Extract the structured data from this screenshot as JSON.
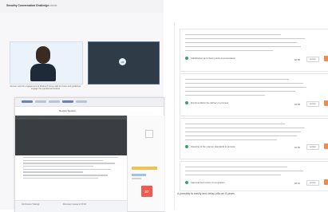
{
  "header": {
    "app_title": "Security Conversation Challenge",
    "crumb": "Standards"
  },
  "left": {
    "caption_line1": "Dunson and the engagement at Rodney? Come with for those and guidelines",
    "caption_line2": "engage the operational reviews",
    "participant_initials": "LB"
  },
  "embedded": {
    "title": "Review Session",
    "footer_left": "Continuous Training",
    "footer_right": "Document review in 00:00",
    "calendar_day": "27"
  },
  "right": {
    "bottom_text": "A possibly to easily and delay pills an 8 years",
    "cards": [
      {
        "label": "Stabilization and check points documentation",
        "time": "02:56",
        "action1": "person",
        "action2": "flag"
      },
      {
        "label": "Documentation the delivery is process",
        "time": "03:05",
        "action1": "person",
        "action2": "flag"
      },
      {
        "label": "Cleaning of the manner standards in process",
        "time": "01:56",
        "action1": "person",
        "action2": "flag"
      },
      {
        "label": "Approval and review of completion",
        "time": "02:16",
        "action1": "person",
        "action2": "flag"
      }
    ]
  },
  "colors": {
    "accent_orange": "#f08a4b",
    "accent_green": "#3aa36b",
    "calendar_red": "#f15b4f"
  }
}
